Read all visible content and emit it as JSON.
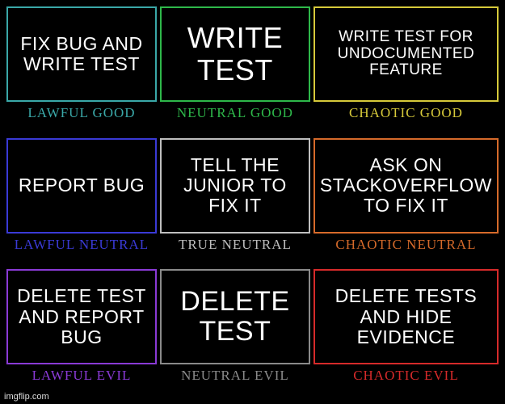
{
  "cells": [
    {
      "content": "FIX BUG AND WRITE TEST",
      "label": "LAWFUL GOOD",
      "colorClass": "c-lg",
      "sizeClass": "fs-md"
    },
    {
      "content": "WRITE TEST",
      "label": "NEUTRAL GOOD",
      "colorClass": "c-ng",
      "sizeClass": "fs-xl"
    },
    {
      "content": "WRITE TEST FOR UNDOCUMENTED FEATURE",
      "label": "CHAOTIC GOOD",
      "colorClass": "c-cg",
      "sizeClass": "fs-sm"
    },
    {
      "content": "REPORT BUG",
      "label": "LAWFUL NEUTRAL",
      "colorClass": "c-ln",
      "sizeClass": "fs-md"
    },
    {
      "content": "TELL THE JUNIOR TO FIX IT",
      "label": "TRUE NEUTRAL",
      "colorClass": "c-tn",
      "sizeClass": "fs-md"
    },
    {
      "content": "ASK ON STACKOVERFLOW TO FIX IT",
      "label": "CHAOTIC NEUTRAL",
      "colorClass": "c-cn",
      "sizeClass": "fs-md"
    },
    {
      "content": "DELETE TEST AND REPORT BUG",
      "label": "LAWFUL EVIL",
      "colorClass": "c-le",
      "sizeClass": "fs-md"
    },
    {
      "content": "DELETE TEST",
      "label": "NEUTRAL EVIL",
      "colorClass": "c-ne",
      "sizeClass": "fs-lg"
    },
    {
      "content": "DELETE TESTS AND HIDE EVIDENCE",
      "label": "CHAOTIC EVIL",
      "colorClass": "c-ce",
      "sizeClass": "fs-md"
    }
  ],
  "watermark": "imgflip.com"
}
